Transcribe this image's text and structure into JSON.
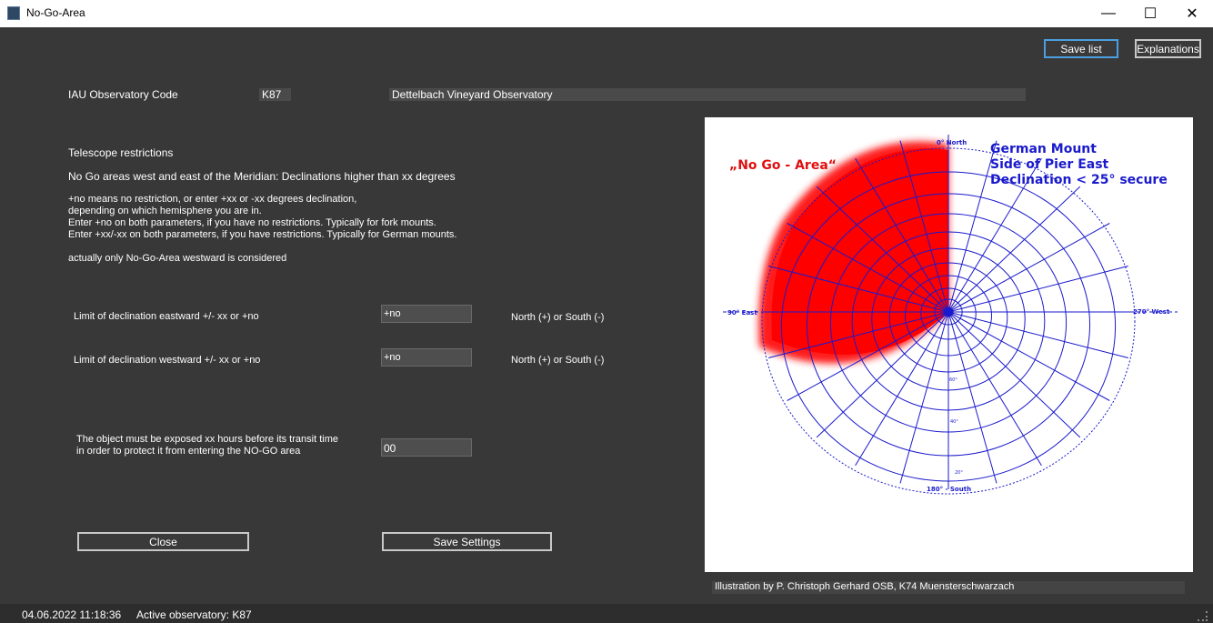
{
  "window": {
    "title": "No-Go-Area",
    "minimize": "—",
    "maximize": "☐",
    "close": "✕"
  },
  "toolbar": {
    "save_list": "Save list",
    "explanations": "Explanations"
  },
  "observatory": {
    "label": "IAU Observatory Code",
    "code": "K87",
    "name": "Dettelbach Vineyard Observatory"
  },
  "restrictions": {
    "heading": "Telescope restrictions",
    "line1": "No Go areas west and east of the Meridian: Declinations higher than xx degrees",
    "line2": "+no means no restriction, or enter +xx or -xx degrees declination,",
    "line3": "depending on which hemisphere you are in.",
    "line4": "Enter +no on both parameters, if you have no restrictions. Typically for fork mounts.",
    "line5": "Enter +xx/-xx on both parameters, if you have restrictions. Typically for German mounts.",
    "note": "actually only No-Go-Area westward is considered"
  },
  "east": {
    "label": "Limit of declination eastward  +/- xx  or +no",
    "value": "+no",
    "hint": "North (+) or South (-)"
  },
  "west": {
    "label": "Limit of declination westward  +/- xx  or +no",
    "value": "+no",
    "hint": "North (+) or South (-)"
  },
  "exposure": {
    "line1": "The object must be exposed xx hours before its transit time",
    "line2": "in order to protect it from entering the NO-GO area",
    "value": "00"
  },
  "buttons": {
    "close": "Close",
    "save_settings": "Save Settings"
  },
  "illustration": {
    "nogo_label": "„No Go - Area“",
    "mount_line1": "German Mount",
    "mount_line2": "Side of Pier East",
    "mount_line3": "Declination < 25° secure",
    "north": "0° North",
    "east": "90° East",
    "west": "270° West",
    "south": "180° - South",
    "dec60": "60°",
    "dec40": "40°",
    "dec20": "20°",
    "credit": "Illustration by P. Christoph Gerhard OSB, K74 Muensterschwarzach"
  },
  "status": {
    "datetime": "04.06.2022 11:18:36",
    "active": "Active observatory: K87"
  },
  "colors": {
    "background": "#383838",
    "nogo": "#ff1a1a",
    "grid": "#1a1acc"
  }
}
